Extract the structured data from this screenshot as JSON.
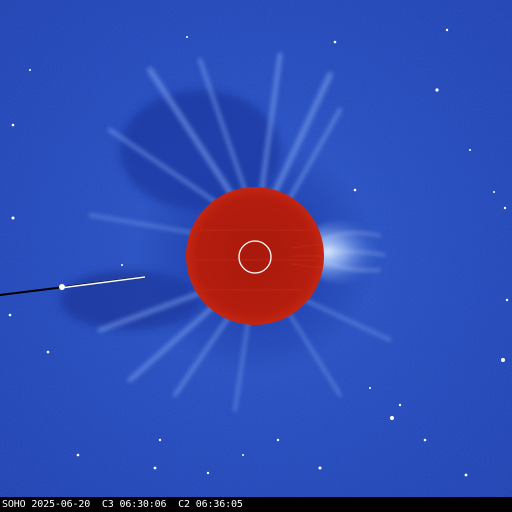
{
  "caption": {
    "observatory": "SOHO",
    "date": "2025-06-20",
    "c3_label": "C3",
    "c3_time": "06:30:06",
    "c2_label": "C2",
    "c2_time": "06:36:05"
  },
  "colors": {
    "background_blue": "#1f45b8",
    "occulter_red": "#b51d0e",
    "caption_bar": "#000000",
    "caption_text": "#ffffff",
    "solar_disk_outline": "#ffffff"
  }
}
